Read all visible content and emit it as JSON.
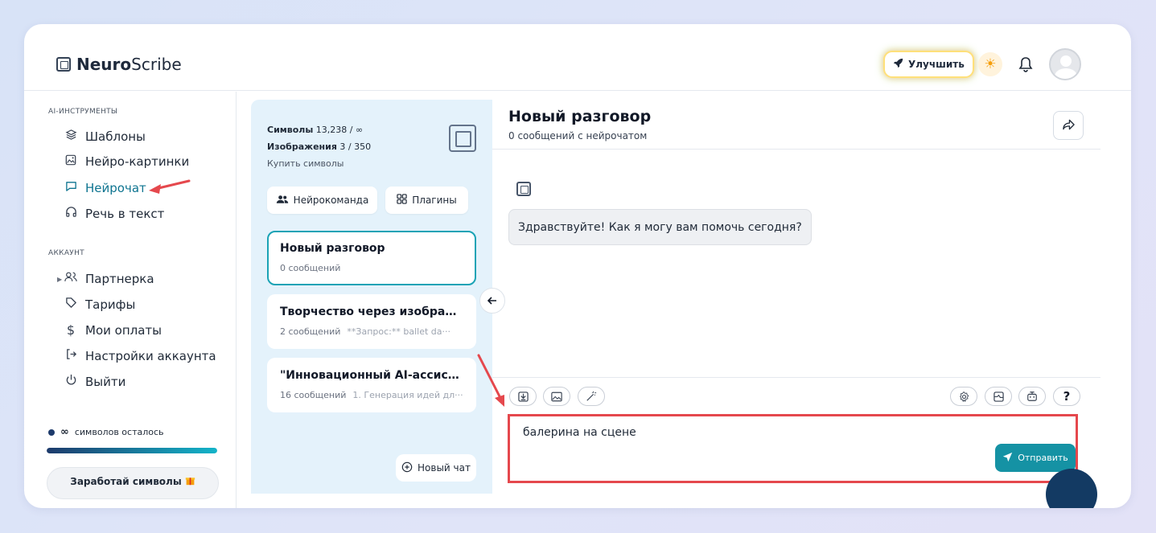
{
  "header": {
    "logo_bold": "Neuro",
    "logo_rest": "Scribe",
    "upgrade_label": "Улучшить"
  },
  "sidebar": {
    "section_ai": "AI-ИНСТРУМЕНТЫ",
    "ai_items": [
      {
        "label": "Шаблоны",
        "icon": "layers-icon"
      },
      {
        "label": "Нейро-картинки",
        "icon": "image-icon"
      },
      {
        "label": "Нейрочат",
        "icon": "chat-icon"
      },
      {
        "label": "Речь в текст",
        "icon": "headphones-icon"
      }
    ],
    "section_account": "АККАУНТ",
    "account_items": [
      {
        "label": "Партнерка",
        "icon": "users-icon"
      },
      {
        "label": "Тарифы",
        "icon": "tag-icon"
      },
      {
        "label": "Мои оплаты",
        "icon": "dollar-icon"
      },
      {
        "label": "Настройки аккаунта",
        "icon": "login-icon"
      },
      {
        "label": "Выйти",
        "icon": "power-icon"
      }
    ],
    "remaining_symbol": "∞",
    "remaining_text": "символов осталось",
    "remaining_fraction": 1.0,
    "earn_label": "Заработай символы"
  },
  "panel": {
    "symbols_label": "Символы",
    "symbols_value": "13,238 / ∞",
    "images_label": "Изображения",
    "images_value": "3 / 350",
    "buy_label": "Купить символы",
    "team_button": "Нейрокоманда",
    "plugins_button": "Плагины",
    "chats": [
      {
        "title": "Новый разговор",
        "count": "0 сообщений",
        "preview": ""
      },
      {
        "title": "Творчество через изображ···",
        "count": "2 сообщений",
        "preview": "**Запрос:** ballet da···"
      },
      {
        "title": "\"Инновационный AI-ассист···",
        "count": "16 сообщений",
        "preview": "1. Генерация идей дл···"
      }
    ],
    "new_chat_label": "Новый чат"
  },
  "chat": {
    "title": "Новый разговор",
    "subtitle": "0 сообщений с нейрочатом",
    "greeting": "Здравствуйте! Как я могу вам помочь сегодня?",
    "input_value": "балерина на сцене",
    "send_label": "Отправить",
    "help_glyph": "?"
  },
  "colors": {
    "accent": "#1592a4",
    "annotation": "#e5484d",
    "brand_dark": "#133a63"
  }
}
